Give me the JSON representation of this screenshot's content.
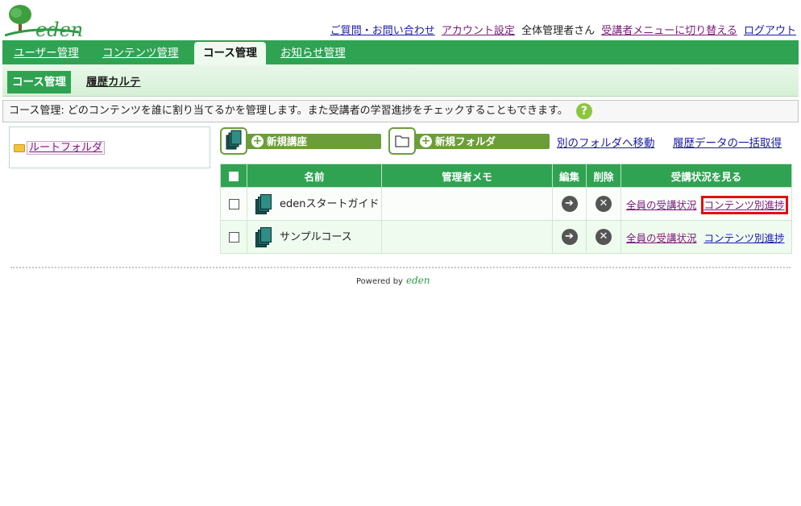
{
  "header": {
    "logo_text": "eden",
    "links": {
      "contact": "ご質問・お問い合わせ",
      "account": "アカウント設定",
      "user": "全体管理者さん",
      "switch_menu": "受講者メニューに切り替える",
      "logout": "ログアウト"
    }
  },
  "main_nav": {
    "tabs": [
      {
        "label": "ユーザー管理",
        "active": false
      },
      {
        "label": "コンテンツ管理",
        "active": false
      },
      {
        "label": "コース管理",
        "active": true
      },
      {
        "label": "お知らせ管理",
        "active": false
      }
    ]
  },
  "sub_nav": {
    "active": "コース管理",
    "link": "履歴カルテ"
  },
  "description": {
    "text": "コース管理: どのコンテンツを誰に割り当てるかを管理します。また受講者の学習進捗をチェックすることもできます。",
    "help_icon": "?"
  },
  "folder_tree": {
    "root": "ルートフォルダ"
  },
  "toolbar": {
    "new_course": "新規講座",
    "new_folder": "新規フォルダ",
    "move": "別のフォルダへ移動",
    "bulk_export": "履歴データの一括取得"
  },
  "table": {
    "headers": {
      "name": "名前",
      "memo": "管理者メモ",
      "edit": "編集",
      "delete": "削除",
      "status": "受講状況を見る"
    },
    "rows": [
      {
        "name": "edenスタートガイド",
        "memo": "",
        "status_all": "全員の受講状況",
        "status_content": "コンテンツ別進捗"
      },
      {
        "name": "サンプルコース",
        "memo": "",
        "status_all": "全員の受講状況",
        "status_content": "コンテンツ別進捗"
      }
    ]
  },
  "footer": {
    "powered_by": "Powered by",
    "logo_text": "eden"
  },
  "colors": {
    "brand_green": "#2fa352",
    "button_green": "#6b9e3a",
    "highlight_red": "#e01010"
  }
}
